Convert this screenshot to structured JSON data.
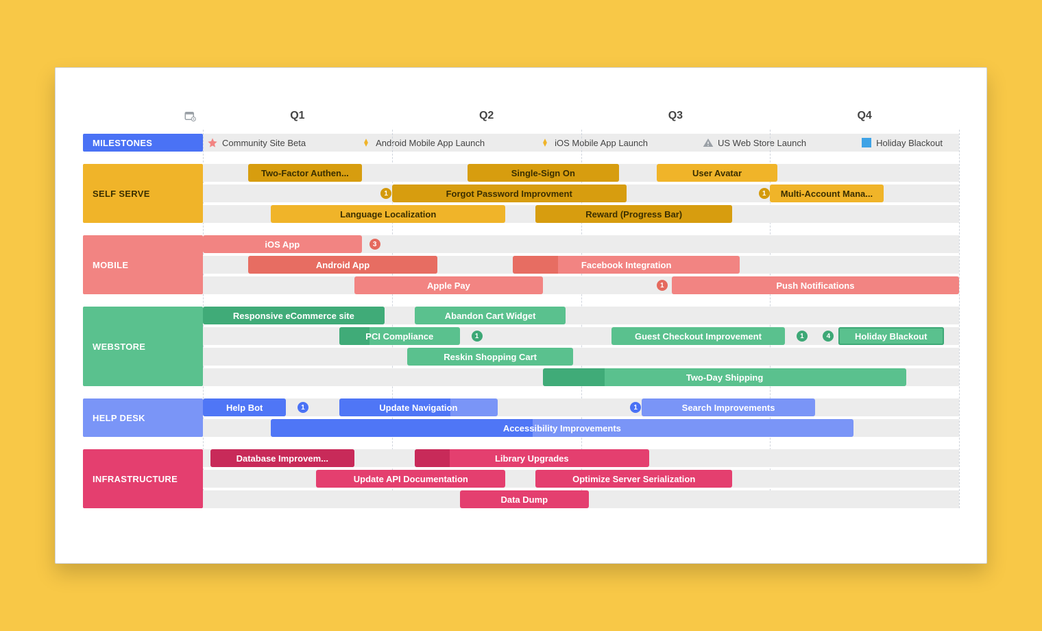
{
  "quarters": [
    "Q1",
    "Q2",
    "Q3",
    "Q4"
  ],
  "milestones_label": "MILESTONES",
  "milestones": [
    {
      "icon": "star",
      "color": "#f28482",
      "label": "Community Site Beta",
      "pos": 6
    },
    {
      "icon": "diamond",
      "color": "#f0b429",
      "label": "Android Mobile App Launch",
      "pos": 25
    },
    {
      "icon": "diamond",
      "color": "#f0b429",
      "label": "iOS Mobile App Launch",
      "pos": 47
    },
    {
      "icon": "warn",
      "color": "#9aa0a6",
      "label": "US Web Store Launch",
      "pos": 67
    },
    {
      "icon": "square",
      "color": "#3fa3e6",
      "label": "Holiday Blackout",
      "pos": 85
    }
  ],
  "lanes": [
    {
      "name": "SELF SERVE",
      "color": "#f0b429",
      "text": "#3b2f00",
      "rows": [
        [
          {
            "label": "Two-Factor Authen...",
            "start": 6,
            "end": 21,
            "fill": "#f0b429",
            "progressFill": "#d49a0c",
            "progress": 100,
            "textDark": true
          },
          {
            "label": "Single-Sign On",
            "start": 35,
            "end": 55,
            "fill": "#f0b429",
            "progressFill": "#d49a0c",
            "progress": 100,
            "textDark": true
          },
          {
            "label": "User Avatar",
            "start": 60,
            "end": 76,
            "fill": "#f0b429",
            "textDark": true
          }
        ],
        [
          {
            "badge": "1",
            "badgeColor": "#d49a0c",
            "badgeAt": 23.5
          },
          {
            "label": "Forgot Password Improvment",
            "start": 25,
            "end": 56,
            "fill": "#f0b429",
            "progressFill": "#d49a0c",
            "progress": 100,
            "textDark": true
          },
          {
            "badge": "1",
            "badgeColor": "#d49a0c",
            "badgeAt": 73.5
          },
          {
            "label": "Multi-Account Mana...",
            "start": 75,
            "end": 90,
            "fill": "#f0b429",
            "textDark": true
          }
        ],
        [
          {
            "label": "Language Localization",
            "start": 9,
            "end": 40,
            "fill": "#f0b429",
            "textDark": true
          },
          {
            "label": "Reward (Progress Bar)",
            "start": 44,
            "end": 70,
            "fill": "#f0b429",
            "progressFill": "#d49a0c",
            "progress": 100,
            "textDark": true
          }
        ]
      ]
    },
    {
      "name": "MOBILE",
      "color": "#f28482",
      "rows": [
        [
          {
            "label": "iOS App",
            "start": 0,
            "end": 21,
            "fill": "#f28482"
          },
          {
            "badge": "3",
            "badgeColor": "#e56a5e",
            "badgeAt": 22
          }
        ],
        [
          {
            "label": "Android App",
            "start": 6,
            "end": 31,
            "fill": "#f28482",
            "progressFill": "#e56a5e",
            "progress": 100
          },
          {
            "label": "Facebook Integration",
            "start": 41,
            "end": 71,
            "fill": "#f28482",
            "progressFill": "#e56a5e",
            "progress": 20
          }
        ],
        [
          {
            "label": "Apple Pay",
            "start": 20,
            "end": 45,
            "fill": "#f28482"
          },
          {
            "badge": "1",
            "badgeColor": "#e56a5e",
            "badgeAt": 60
          },
          {
            "label": "Push Notifications",
            "start": 62,
            "end": 100,
            "fill": "#f28482"
          }
        ]
      ]
    },
    {
      "name": "WEBSTORE",
      "color": "#5ac18e",
      "rows": [
        [
          {
            "label": "Responsive eCommerce site",
            "start": 0,
            "end": 24,
            "fill": "#5ac18e",
            "progressFill": "#3da876",
            "progress": 100
          },
          {
            "label": "Abandon Cart Widget",
            "start": 28,
            "end": 48,
            "fill": "#5ac18e"
          }
        ],
        [
          {
            "label": "PCI Compliance",
            "start": 18,
            "end": 34,
            "fill": "#5ac18e",
            "progressFill": "#3da876",
            "progress": 25
          },
          {
            "badge": "1",
            "badgeColor": "#3da876",
            "badgeAt": 35.5
          },
          {
            "label": "Guest Checkout Improvement",
            "start": 54,
            "end": 77,
            "fill": "#5ac18e"
          },
          {
            "badge": "1",
            "badgeColor": "#3da876",
            "badgeAt": 78.5
          },
          {
            "badge": "4",
            "badgeColor": "#3da876",
            "badgeAt": 82
          },
          {
            "label": "Holiday Blackout",
            "start": 84,
            "end": 98,
            "fill": "#5ac18e",
            "border": "#3da876"
          }
        ],
        [
          {
            "label": "Reskin Shopping Cart",
            "start": 27,
            "end": 49,
            "fill": "#5ac18e"
          }
        ],
        [
          {
            "label": "Two-Day Shipping",
            "start": 45,
            "end": 93,
            "fill": "#5ac18e",
            "progressFill": "#3da876",
            "progress": 17
          }
        ]
      ]
    },
    {
      "name": "HELP DESK",
      "color": "#7a95f7",
      "rows": [
        [
          {
            "label": "Help Bot",
            "start": 0,
            "end": 11,
            "fill": "#7a95f7",
            "progressFill": "#4a72f5",
            "progress": 100
          },
          {
            "badge": "1",
            "badgeColor": "#4a72f5",
            "badgeAt": 12.5
          },
          {
            "label": "Update Navigation",
            "start": 18,
            "end": 39,
            "fill": "#7a95f7",
            "progressFill": "#4a72f5",
            "progress": 70
          },
          {
            "badge": "1",
            "badgeColor": "#4a72f5",
            "badgeAt": 56.5
          },
          {
            "label": "Search Improvements",
            "start": 58,
            "end": 81,
            "fill": "#7a95f7"
          }
        ],
        [
          {
            "label": "Accessibility Improvements",
            "start": 9,
            "end": 86,
            "fill": "#7a95f7",
            "progressFill": "#4a72f5",
            "progress": 45
          }
        ]
      ]
    },
    {
      "name": "INFRASTRUCTURE",
      "color": "#e43f6f",
      "rows": [
        [
          {
            "label": "Database Improvem...",
            "start": 1,
            "end": 20,
            "fill": "#e43f6f",
            "progressFill": "#c42857",
            "progress": 100
          },
          {
            "label": "Library Upgrades",
            "start": 28,
            "end": 59,
            "fill": "#e43f6f",
            "progressFill": "#c42857",
            "progress": 15
          }
        ],
        [
          {
            "label": "Update API Documentation",
            "start": 15,
            "end": 40,
            "fill": "#e43f6f"
          },
          {
            "label": "Optimize Server Serialization",
            "start": 44,
            "end": 70,
            "fill": "#e43f6f"
          }
        ],
        [
          {
            "label": "Data Dump",
            "start": 34,
            "end": 51,
            "fill": "#e43f6f"
          }
        ]
      ]
    }
  ]
}
